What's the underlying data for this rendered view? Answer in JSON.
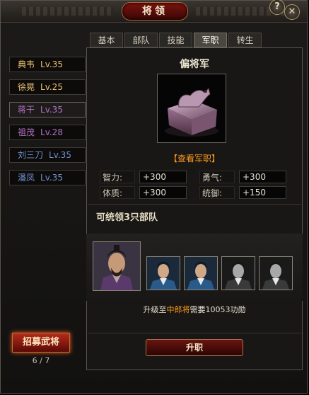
{
  "window": {
    "title": "将领",
    "help_icon": "?",
    "close_icon": "✕"
  },
  "generals": [
    {
      "name": "典韦",
      "level": "Lv.35",
      "color": "#e8c070",
      "selected": false
    },
    {
      "name": "徐晃",
      "level": "Lv.25",
      "color": "#e8c070",
      "selected": false
    },
    {
      "name": "蒋干",
      "level": "Lv.35",
      "color": "#b070c0",
      "selected": true
    },
    {
      "name": "祖茂",
      "level": "Lv.28",
      "color": "#b070c0",
      "selected": false
    },
    {
      "name": "刘三刀",
      "level": "Lv.35",
      "color": "#7090d0",
      "selected": false
    },
    {
      "name": "潘凤",
      "level": "Lv.35",
      "color": "#7090d0",
      "selected": false
    }
  ],
  "recruit": {
    "label": "招募武将",
    "count": "6 / 7"
  },
  "tabs": [
    {
      "label": "基本",
      "active": false
    },
    {
      "label": "部队",
      "active": false
    },
    {
      "label": "技能",
      "active": false
    },
    {
      "label": "军职",
      "active": true
    },
    {
      "label": "转生",
      "active": false
    }
  ],
  "rank": {
    "title": "偏将军",
    "seal_icon": "jade-seal-icon",
    "view_link": "【查看军职】"
  },
  "stats": {
    "intelligence": {
      "label": "智力:",
      "value": "+300"
    },
    "courage": {
      "label": "勇气:",
      "value": "+300"
    },
    "physique": {
      "label": "体质:",
      "value": "+300"
    },
    "command": {
      "label": "统御:",
      "value": "+150"
    }
  },
  "troops": {
    "command_text": "可统领3只部队",
    "slots": [
      {
        "type": "general",
        "unlocked": true
      },
      {
        "type": "soldier",
        "unlocked": true
      },
      {
        "type": "soldier",
        "unlocked": true
      },
      {
        "type": "soldier",
        "unlocked": false
      },
      {
        "type": "soldier",
        "unlocked": false
      }
    ]
  },
  "upgrade": {
    "prefix": "升级至",
    "target": "中郎将",
    "suffix": "需要10053功勋"
  },
  "promote_button": "升职"
}
